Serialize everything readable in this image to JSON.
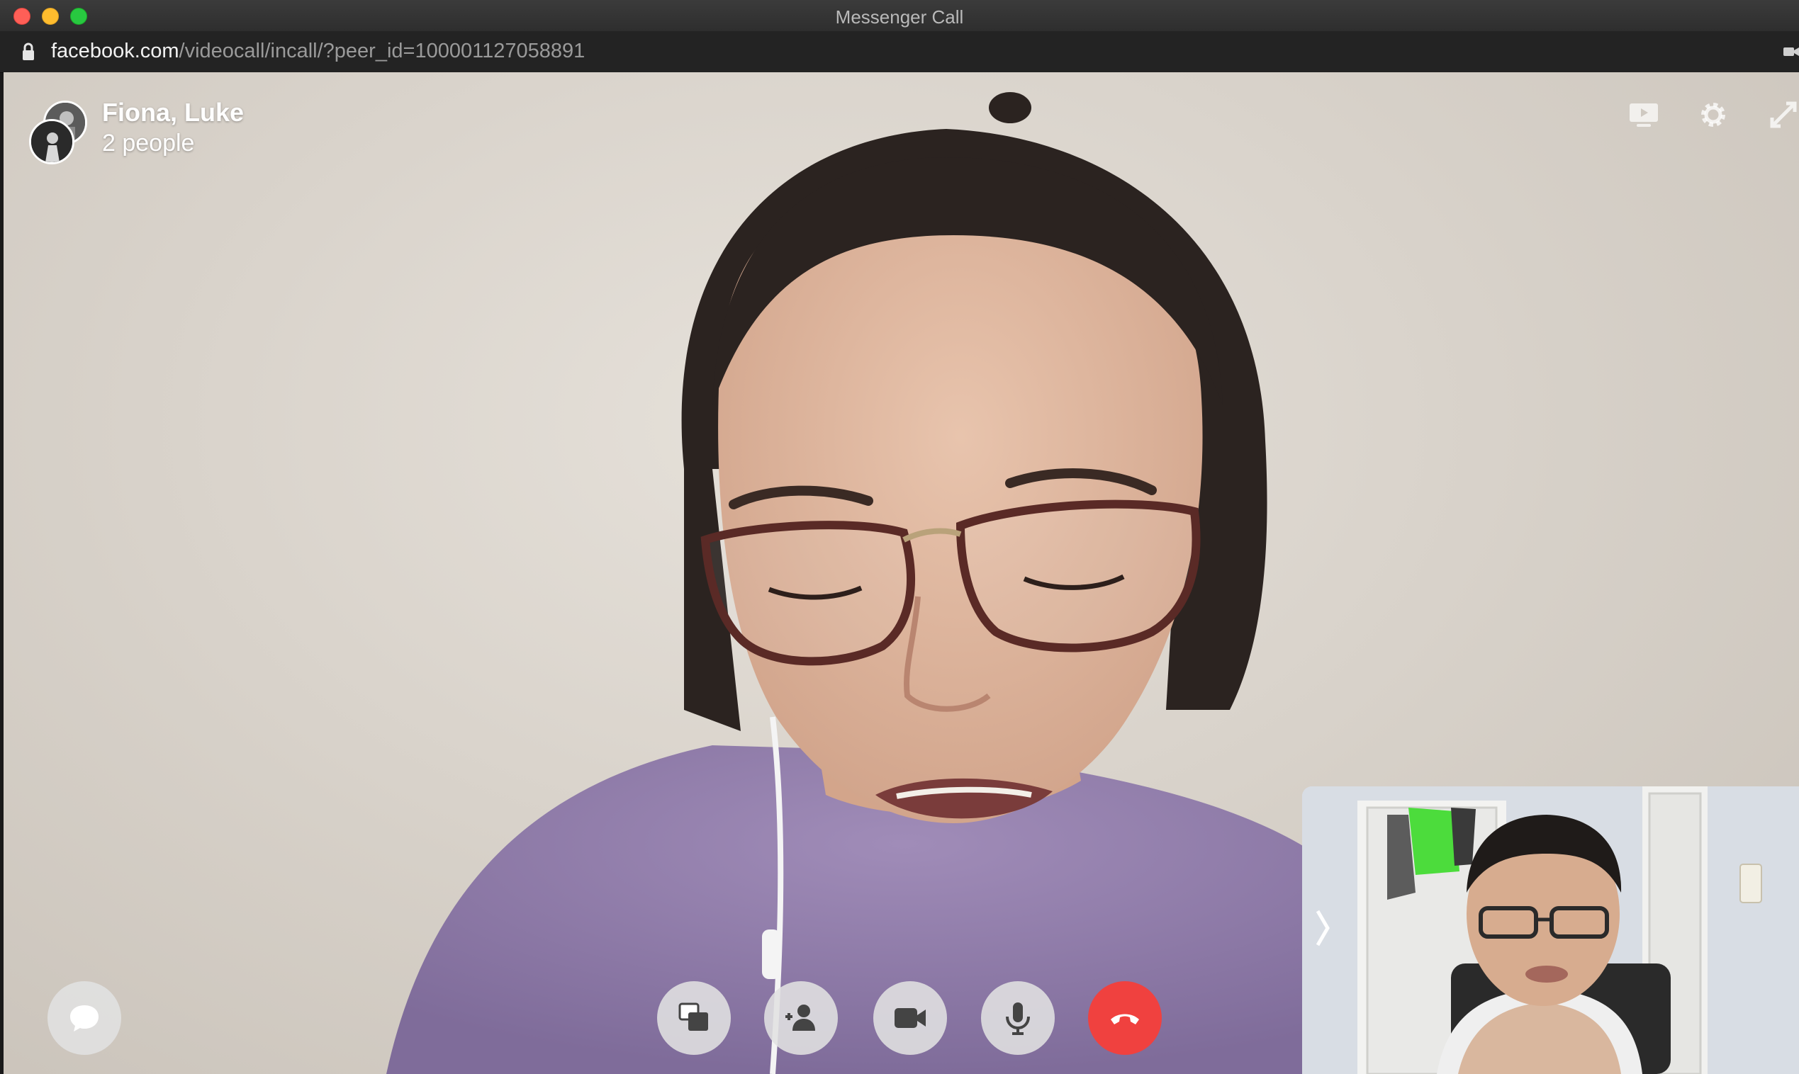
{
  "window": {
    "title": "Messenger Call"
  },
  "address_bar": {
    "url_host": "facebook.com",
    "url_path": "/videocall/incall/?peer_id=100001127058891"
  },
  "call": {
    "participants_label": "Fiona, Luke",
    "count_label": "2 people"
  },
  "controls": {
    "icons": [
      "chat-icon",
      "screen-share-icon",
      "add-person-icon",
      "video-camera-icon",
      "microphone-icon",
      "end-call-icon"
    ],
    "end_call_color": "#f0413f"
  },
  "top_actions": {
    "icons": [
      "screen-icon",
      "gear-icon",
      "expand-icon"
    ]
  },
  "self_view": {
    "collapse_icon": "chevron-right-icon"
  }
}
